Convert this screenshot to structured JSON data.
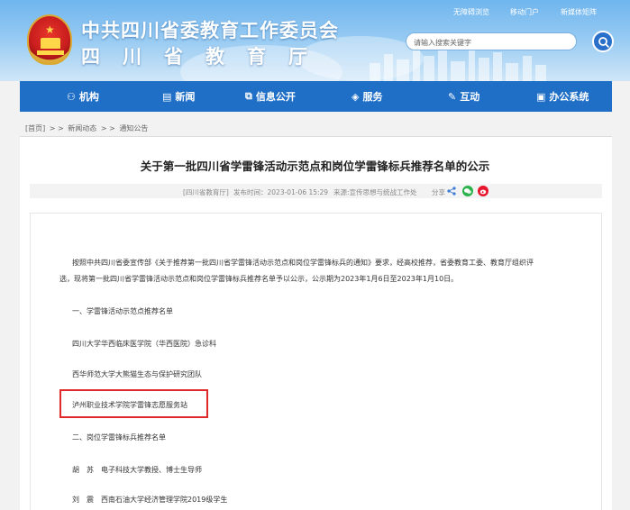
{
  "header": {
    "org_name": "中共四川省委教育工作委员会",
    "dept_name": "四川省教育厅",
    "top_links": [
      "无障碍浏览",
      "移动门户",
      "新媒体矩阵"
    ],
    "search_placeholder": "请输入搜索关键字"
  },
  "nav": {
    "items": [
      {
        "icon": "org-icon",
        "label": "机构"
      },
      {
        "icon": "news-icon",
        "label": "新闻"
      },
      {
        "icon": "info-icon",
        "label": "信息公开"
      },
      {
        "icon": "service-icon",
        "label": "服务"
      },
      {
        "icon": "interact-icon",
        "label": "互动"
      },
      {
        "icon": "office-icon",
        "label": "办公系统"
      }
    ]
  },
  "breadcrumb": {
    "items": [
      "[首页]",
      "> >",
      "新闻动态",
      "> >",
      "通知公告"
    ]
  },
  "article": {
    "title": "关于第一批四川省学雷锋活动示范点和岗位学雷锋标兵推荐名单的公示",
    "meta": {
      "source": "[四川省教育厅]",
      "published": "发布时间：2023-01-06 15:29",
      "origin": "来源:宣传思想与统战工作处",
      "share_label": "分享"
    },
    "paragraphs": [
      "按照中共四川省委宣传部《关于推荐第一批四川省学雷锋活动示范点和岗位学雷锋标兵的通知》要求，经高校推荐，省委教育工委、教育厅组织评",
      "选，现将第一批四川省学雷锋活动示范点和岗位学雷锋标兵推荐名单予以公示，公示期为2023年1月6日至2023年1月10日。",
      "一、学雷锋活动示范点推荐名单",
      "四川大学华西临床医学院（华西医院）急诊科",
      "西华师范大学大熊猫生态与保护研究团队",
      "泸州职业技术学院学雷锋志愿服务站",
      "二、岗位学雷锋标兵推荐名单",
      "胡　苏　电子科技大学教授、博士生导师",
      "刘　震　西南石油大学经济管理学院2019级学生"
    ]
  },
  "colors": {
    "nav_bg": "#1f6fc7",
    "highlight_border": "#e02a2a"
  }
}
